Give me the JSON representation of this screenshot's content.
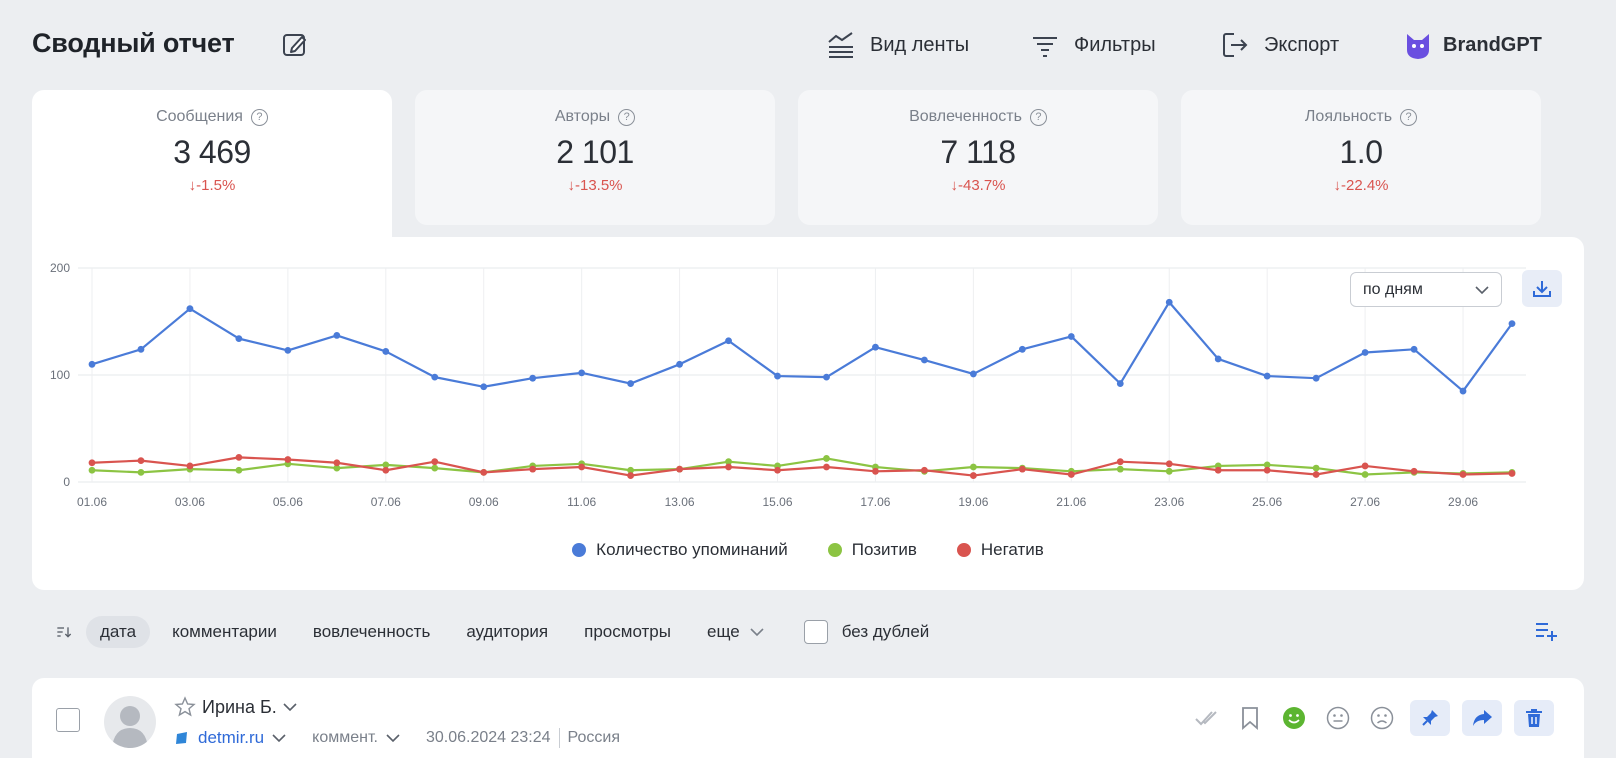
{
  "header": {
    "title": "Сводный отчет",
    "feed_view": "Вид ленты",
    "filters": "Фильтры",
    "export": "Экспорт",
    "brand": "BrandGPT"
  },
  "stats": [
    {
      "label": "Сообщения",
      "value": "3 469",
      "change": "↓-1.5%"
    },
    {
      "label": "Авторы",
      "value": "2 101",
      "change": "↓-13.5%"
    },
    {
      "label": "Вовлеченность",
      "value": "7 118",
      "change": "↓-43.7%"
    },
    {
      "label": "Лояльность",
      "value": "1.0",
      "change": "↓-22.4%"
    }
  ],
  "chart_controls": {
    "period": "по дням"
  },
  "chart_data": {
    "type": "line",
    "x": [
      "01.06",
      "02.06",
      "03.06",
      "04.06",
      "05.06",
      "06.06",
      "07.06",
      "08.06",
      "09.06",
      "10.06",
      "11.06",
      "12.06",
      "13.06",
      "14.06",
      "15.06",
      "16.06",
      "17.06",
      "18.06",
      "19.06",
      "20.06",
      "21.06",
      "22.06",
      "23.06",
      "24.06",
      "25.06",
      "26.06",
      "27.06",
      "28.06",
      "29.06",
      "30.06"
    ],
    "x_tick_labels": [
      "01.06",
      "03.06",
      "05.06",
      "07.06",
      "09.06",
      "11.06",
      "13.06",
      "15.06",
      "17.06",
      "19.06",
      "21.06",
      "23.06",
      "25.06",
      "27.06",
      "29.06"
    ],
    "y_ticks": [
      0,
      100,
      200
    ],
    "ylim": [
      0,
      200
    ],
    "grid": true,
    "legend_position": "bottom",
    "series": [
      {
        "name": "Количество упоминаний",
        "color": "#4a7bd8",
        "values": [
          110,
          124,
          162,
          134,
          123,
          137,
          122,
          98,
          89,
          97,
          102,
          92,
          110,
          132,
          99,
          98,
          126,
          114,
          101,
          124,
          136,
          92,
          168,
          115,
          99,
          97,
          121,
          124,
          85,
          148
        ]
      },
      {
        "name": "Позитив",
        "color": "#8cc443",
        "values": [
          11,
          9,
          12,
          11,
          17,
          13,
          16,
          13,
          9,
          15,
          17,
          11,
          12,
          19,
          15,
          22,
          14,
          10,
          14,
          13,
          10,
          12,
          10,
          15,
          16,
          13,
          7,
          9,
          8,
          9
        ]
      },
      {
        "name": "Негатив",
        "color": "#d9544f",
        "values": [
          18,
          20,
          15,
          23,
          21,
          18,
          11,
          19,
          9,
          12,
          14,
          6,
          12,
          14,
          11,
          14,
          10,
          11,
          6,
          12,
          7,
          19,
          17,
          11,
          11,
          7,
          15,
          10,
          7,
          8
        ]
      }
    ]
  },
  "sort": {
    "options": [
      "дата",
      "комментарии",
      "вовлеченность",
      "аудитория",
      "просмотры",
      "еще"
    ],
    "no_duplicates": "без дублей"
  },
  "post": {
    "author": "Ирина Б.",
    "site": "detmir.ru",
    "type": "коммент.",
    "datetime": "30.06.2024 23:24",
    "country": "Россия"
  },
  "colors": {
    "accent": "#2f6ad8",
    "negative": "#d9544f",
    "positive": "#8cc443"
  }
}
